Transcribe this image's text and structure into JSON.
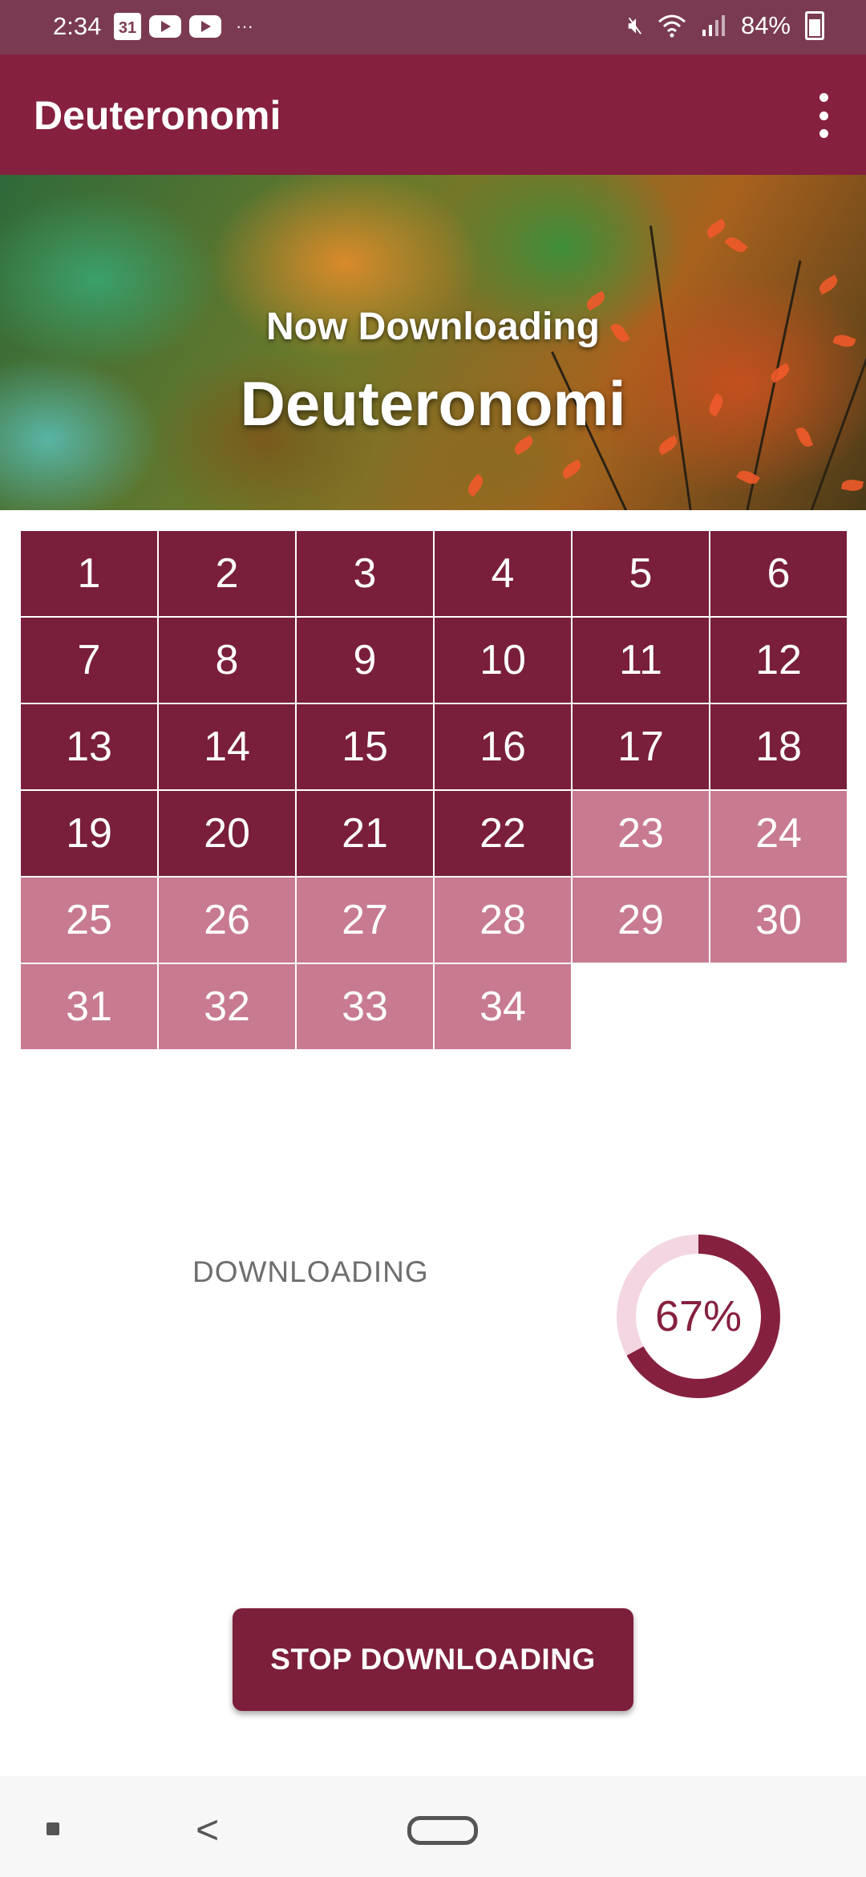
{
  "status_bar": {
    "time": "2:34",
    "calendar_badge": "31",
    "overflow": "···",
    "battery": "84%",
    "icons": [
      "calendar-icon",
      "youtube-icon",
      "youtube-icon",
      "mute-icon",
      "wifi-icon",
      "signal-icon",
      "battery-icon"
    ]
  },
  "app_bar": {
    "title": "Deuteronomi",
    "menu_icon": "more-vert-icon"
  },
  "banner": {
    "subtitle": "Now Downloading",
    "title": "Deuteronomi"
  },
  "chapters": {
    "total": 34,
    "completed": 22,
    "items": [
      "1",
      "2",
      "3",
      "4",
      "5",
      "6",
      "7",
      "8",
      "9",
      "10",
      "11",
      "12",
      "13",
      "14",
      "15",
      "16",
      "17",
      "18",
      "19",
      "20",
      "21",
      "22",
      "23",
      "24",
      "25",
      "26",
      "27",
      "28",
      "29",
      "30",
      "31",
      "32",
      "33",
      "34"
    ]
  },
  "progress": {
    "label": "DOWNLOADING",
    "percent": 67,
    "percent_text": "67%"
  },
  "actions": {
    "stop_label": "STOP DOWNLOADING"
  },
  "colors": {
    "primary": "#86203f",
    "chapter_done": "#791f3b",
    "chapter_pending": "#c77a90",
    "ring_track": "#f3d6e2",
    "status_bar": "#7a3b52"
  },
  "nav_bar": {
    "icons": [
      "recent-apps-icon",
      "back-icon",
      "home-icon"
    ]
  }
}
